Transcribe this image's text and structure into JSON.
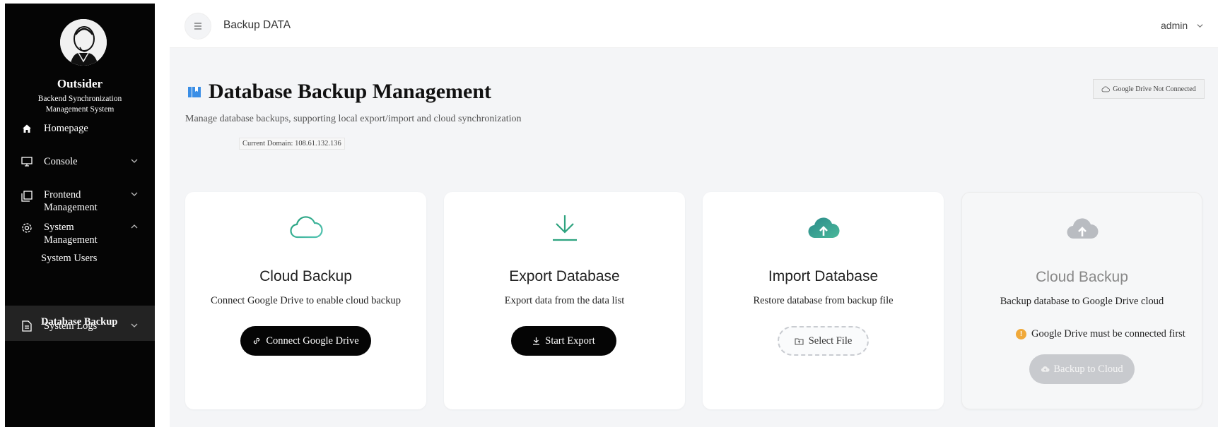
{
  "sidebar": {
    "brand_name": "Outsider",
    "brand_sub_line1": "Backend Synchronization",
    "brand_sub_line2": "Management System",
    "items": [
      {
        "label": "Homepage",
        "icon": "home-icon"
      },
      {
        "label": "Console",
        "icon": "monitor-icon"
      },
      {
        "label_line1": "Frontend",
        "label_line2": "Management",
        "icon": "copy-icon"
      },
      {
        "label_line1": "System",
        "label_line2": "Management",
        "icon": "gear-icon"
      },
      {
        "label": "System Users"
      },
      {
        "label": "Database Backup"
      },
      {
        "label": "System Logs",
        "icon": "document-icon"
      }
    ]
  },
  "header": {
    "menu_icon": "hamburger-icon",
    "tab_title": "Backup DATA",
    "user": "admin"
  },
  "main": {
    "title": "Database Backup Management",
    "description": "Manage database backups, supporting local export/import and cloud synchronization",
    "domain_label": "Current Domain: 108.61.132.136",
    "drive_status": "Google Drive Not Connected",
    "accent_color": "#3a8ee6",
    "cards": [
      {
        "title": "Cloud Backup",
        "desc": "Connect Google Drive to enable cloud backup",
        "button": "Connect Google Drive",
        "icon": "cloud-outline-icon"
      },
      {
        "title": "Export Database",
        "desc": "Export data from the data list",
        "button": "Start Export",
        "icon": "download-icon"
      },
      {
        "title": "Import Database",
        "desc": "Restore database from backup file",
        "button": "Select File",
        "icon": "cloud-upload-icon"
      },
      {
        "title": "Cloud Backup",
        "desc": "Backup database to Google Drive cloud",
        "warning": "Google Drive must be connected first",
        "button": "Backup to Cloud",
        "icon": "cloud-upload-icon"
      }
    ]
  }
}
